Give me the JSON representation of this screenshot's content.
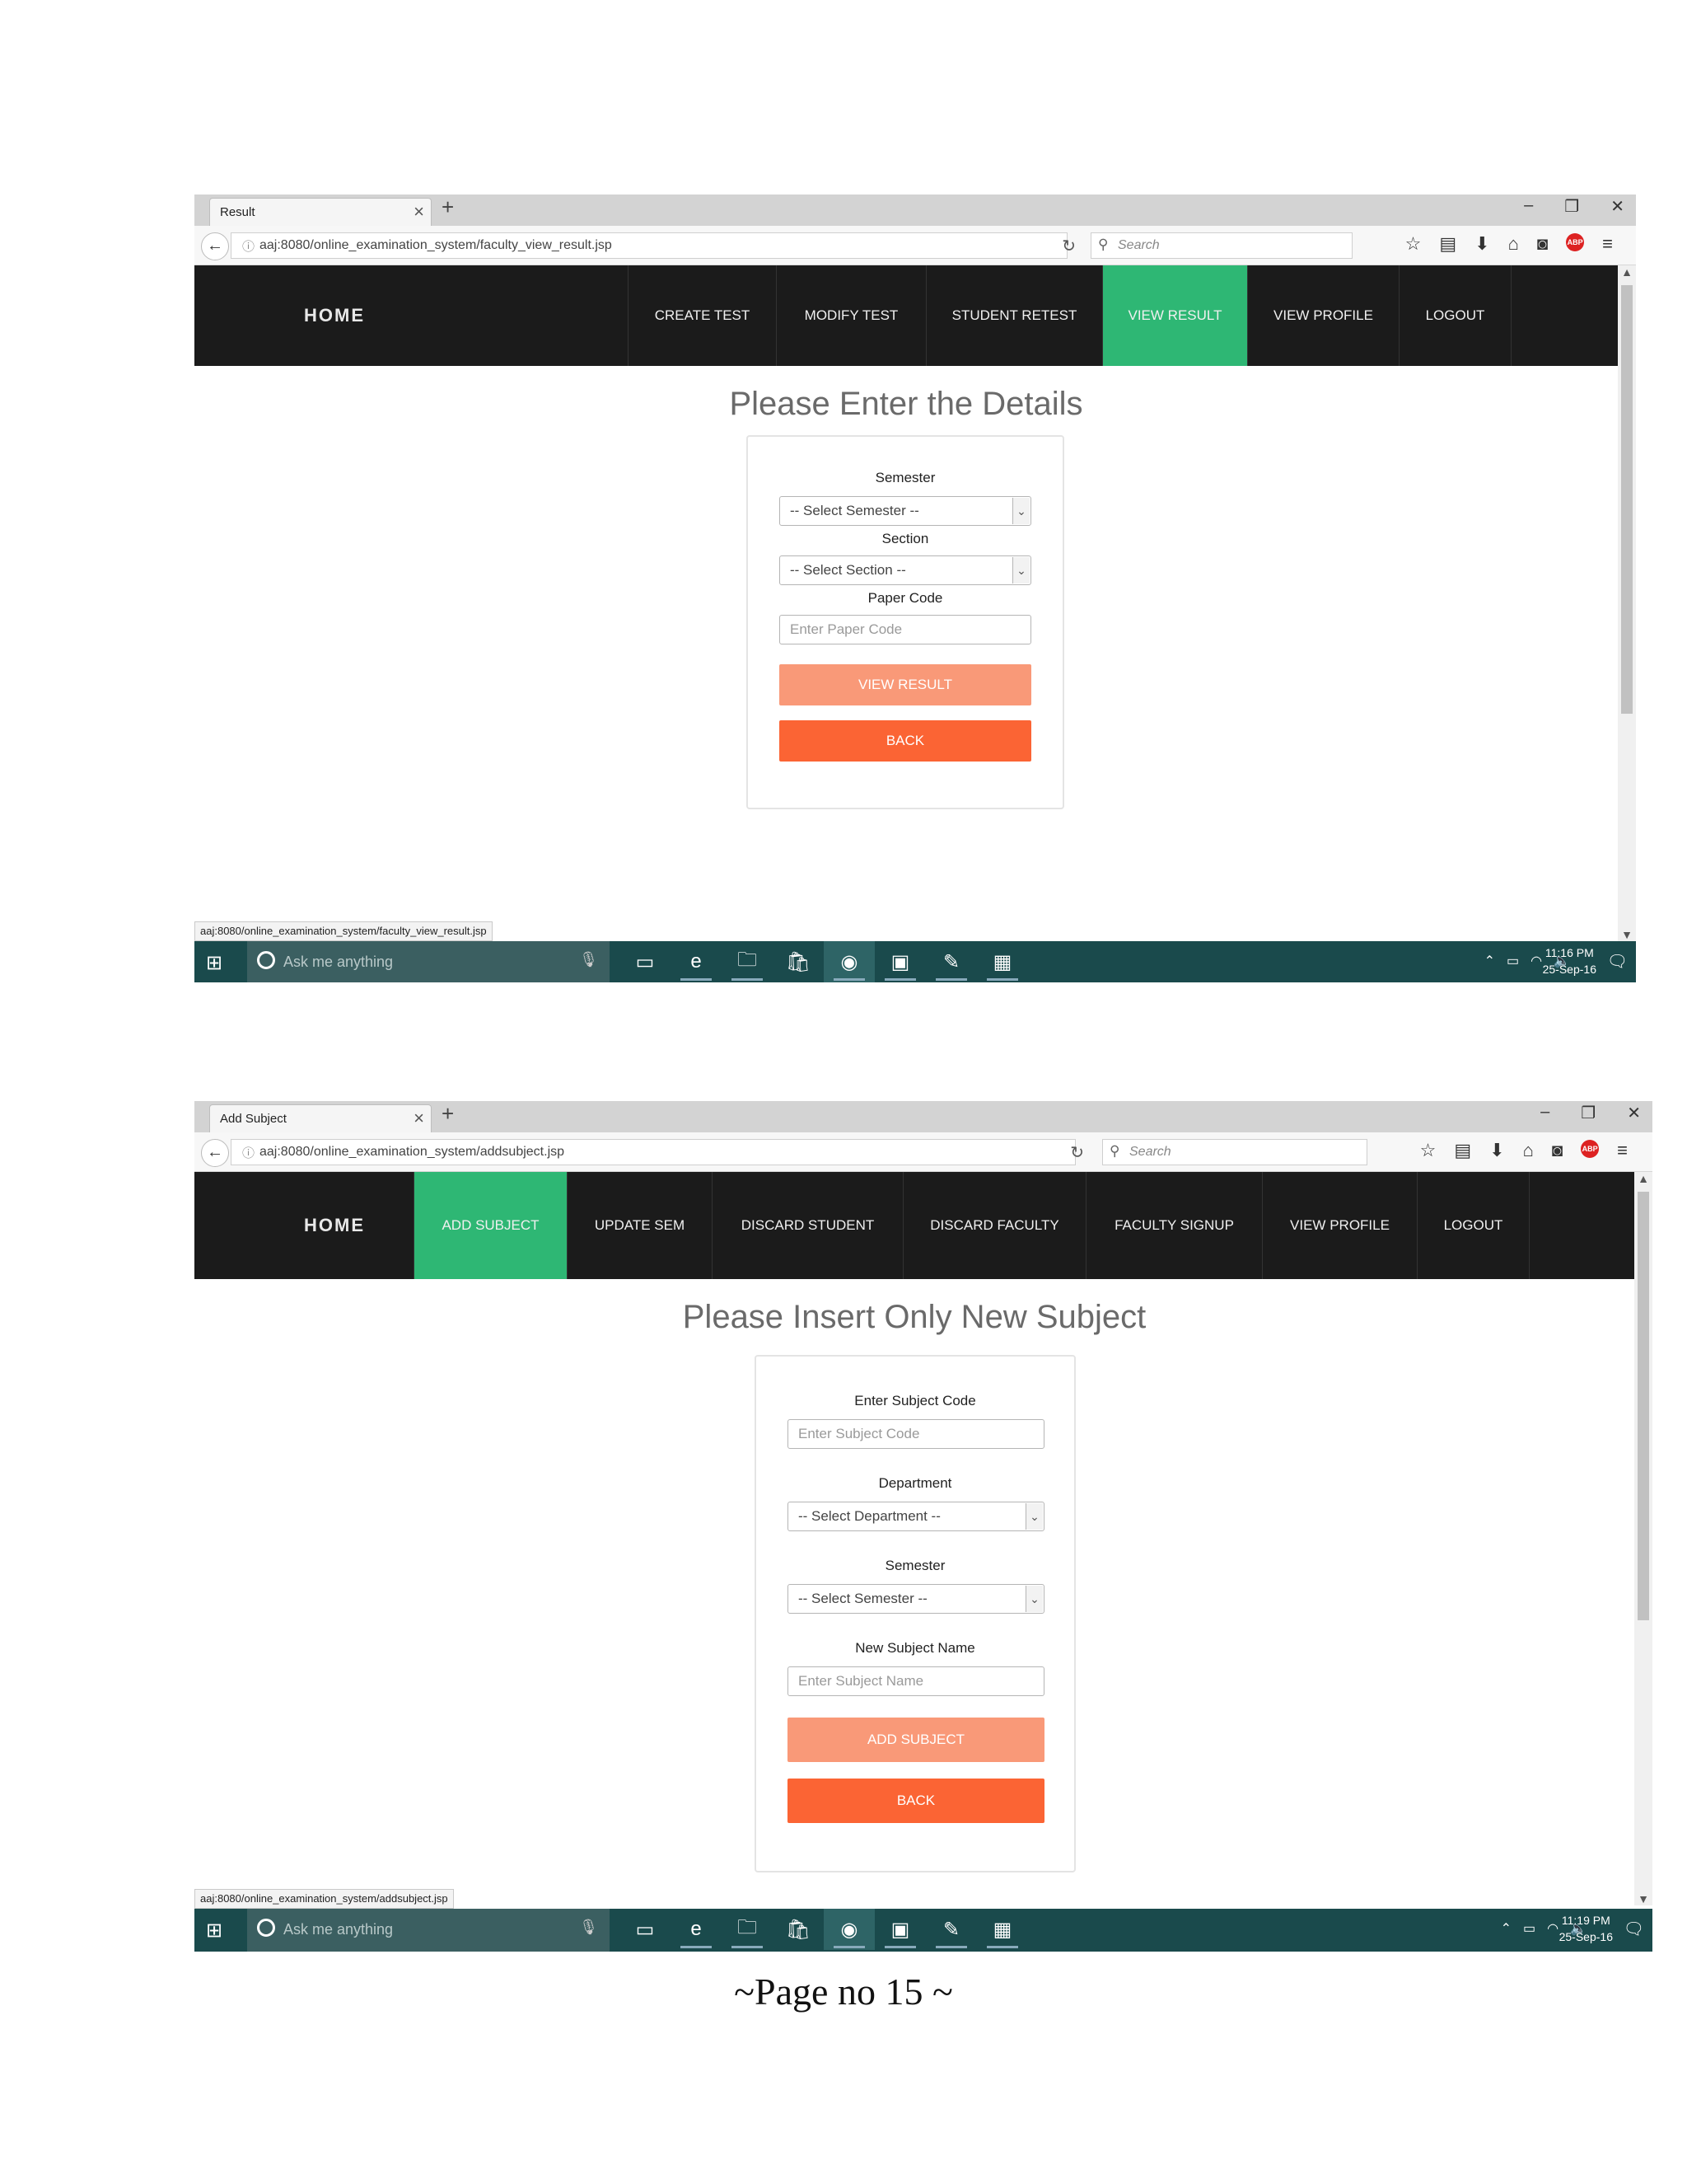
{
  "screenshot1": {
    "tab_title": "Result",
    "url": "aaj:8080/online_examination_system/faculty_view_result.jsp",
    "search_placeholder": "Search",
    "nav": {
      "home": "HOME",
      "items": [
        "CREATE TEST",
        "MODIFY TEST",
        "STUDENT RETEST",
        "VIEW RESULT",
        "VIEW PROFILE",
        "LOGOUT"
      ],
      "active": "VIEW RESULT"
    },
    "heading": "Please Enter the Details",
    "form": {
      "semester_label": "Semester",
      "semester_select": "-- Select Semester --",
      "section_label": "Section",
      "section_select": "-- Select Section --",
      "paper_code_label": "Paper Code",
      "paper_code_placeholder": "Enter Paper Code",
      "view_result_button": "VIEW RESULT",
      "back_button": "BACK"
    },
    "status_url": "aaj:8080/online_examination_system/faculty_view_result.jsp",
    "taskbar": {
      "search_text": "Ask me anything",
      "time": "11:16 PM",
      "date": "25-Sep-16"
    }
  },
  "screenshot2": {
    "tab_title": "Add Subject",
    "url": "aaj:8080/online_examination_system/addsubject.jsp",
    "search_placeholder": "Search",
    "nav": {
      "home": "HOME",
      "items": [
        "ADD SUBJECT",
        "UPDATE SEM",
        "DISCARD STUDENT",
        "DISCARD FACULTY",
        "FACULTY SIGNUP",
        "VIEW PROFILE",
        "LOGOUT"
      ],
      "active": "ADD SUBJECT"
    },
    "heading": "Please Insert Only New Subject",
    "form": {
      "subject_code_label": "Enter Subject Code",
      "subject_code_placeholder": "Enter Subject Code",
      "department_label": "Department",
      "department_select": "-- Select Department --",
      "semester_label": "Semester",
      "semester_select": "-- Select Semester --",
      "subject_name_label": "New Subject Name",
      "subject_name_placeholder": "Enter Subject Name",
      "add_subject_button": "ADD SUBJECT",
      "back_button": "BACK"
    },
    "status_url": "aaj:8080/online_examination_system/addsubject.jsp",
    "taskbar": {
      "search_text": "Ask me anything",
      "time": "11:19 PM",
      "date": "25-Sep-16"
    }
  },
  "footer": "~Page no 15 ~"
}
